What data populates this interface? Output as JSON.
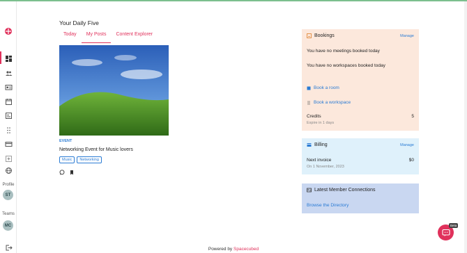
{
  "sidebar": {
    "profile_label": "Profile",
    "profile_initials": "ST",
    "teams_label": "Teams",
    "teams_initials": "MC",
    "icons": [
      "dashboard-icon",
      "people-icon",
      "id-card-icon",
      "calendar-icon",
      "booking-icon",
      "grid-dots-icon",
      "card-icon",
      "add-box-icon",
      "globe-icon",
      "logout-icon"
    ]
  },
  "main": {
    "title": "Your Daily Five",
    "tabs": [
      {
        "label": "Today",
        "active": false
      },
      {
        "label": "My Posts",
        "active": true
      },
      {
        "label": "Content Explorer",
        "active": false
      }
    ],
    "post": {
      "type": "EVENT",
      "title": "Networking Event for Music lovers",
      "tags": [
        "Music",
        "Networking"
      ]
    }
  },
  "bookings": {
    "title": "Bookings",
    "manage": "Manage",
    "no_meetings": "You have no meetings booked today",
    "no_workspaces": "You have no workspaces booked today",
    "book_room": "Book a room",
    "book_workspace": "Book a workspace",
    "credits_label": "Credits",
    "credits_value": "5",
    "credits_expiry": "Expire in 1 days"
  },
  "billing": {
    "title": "Billing",
    "manage": "Manage",
    "next_invoice_label": "Next invoice",
    "next_invoice_amount": "$0",
    "next_invoice_date": "On 1 November, 2023"
  },
  "members": {
    "title": "Latest Member Connections",
    "browse": "Browse the Directory"
  },
  "footer": {
    "powered_by": "Powered by",
    "brand": "Spacecubed"
  },
  "chat": {
    "badge": "Beta"
  },
  "colors": {
    "accent": "#e0315b",
    "link": "#2a7bd4",
    "bookings_bg": "#fce8dc",
    "billing_bg": "#dff1fb",
    "members_bg": "#c9d7f1"
  }
}
